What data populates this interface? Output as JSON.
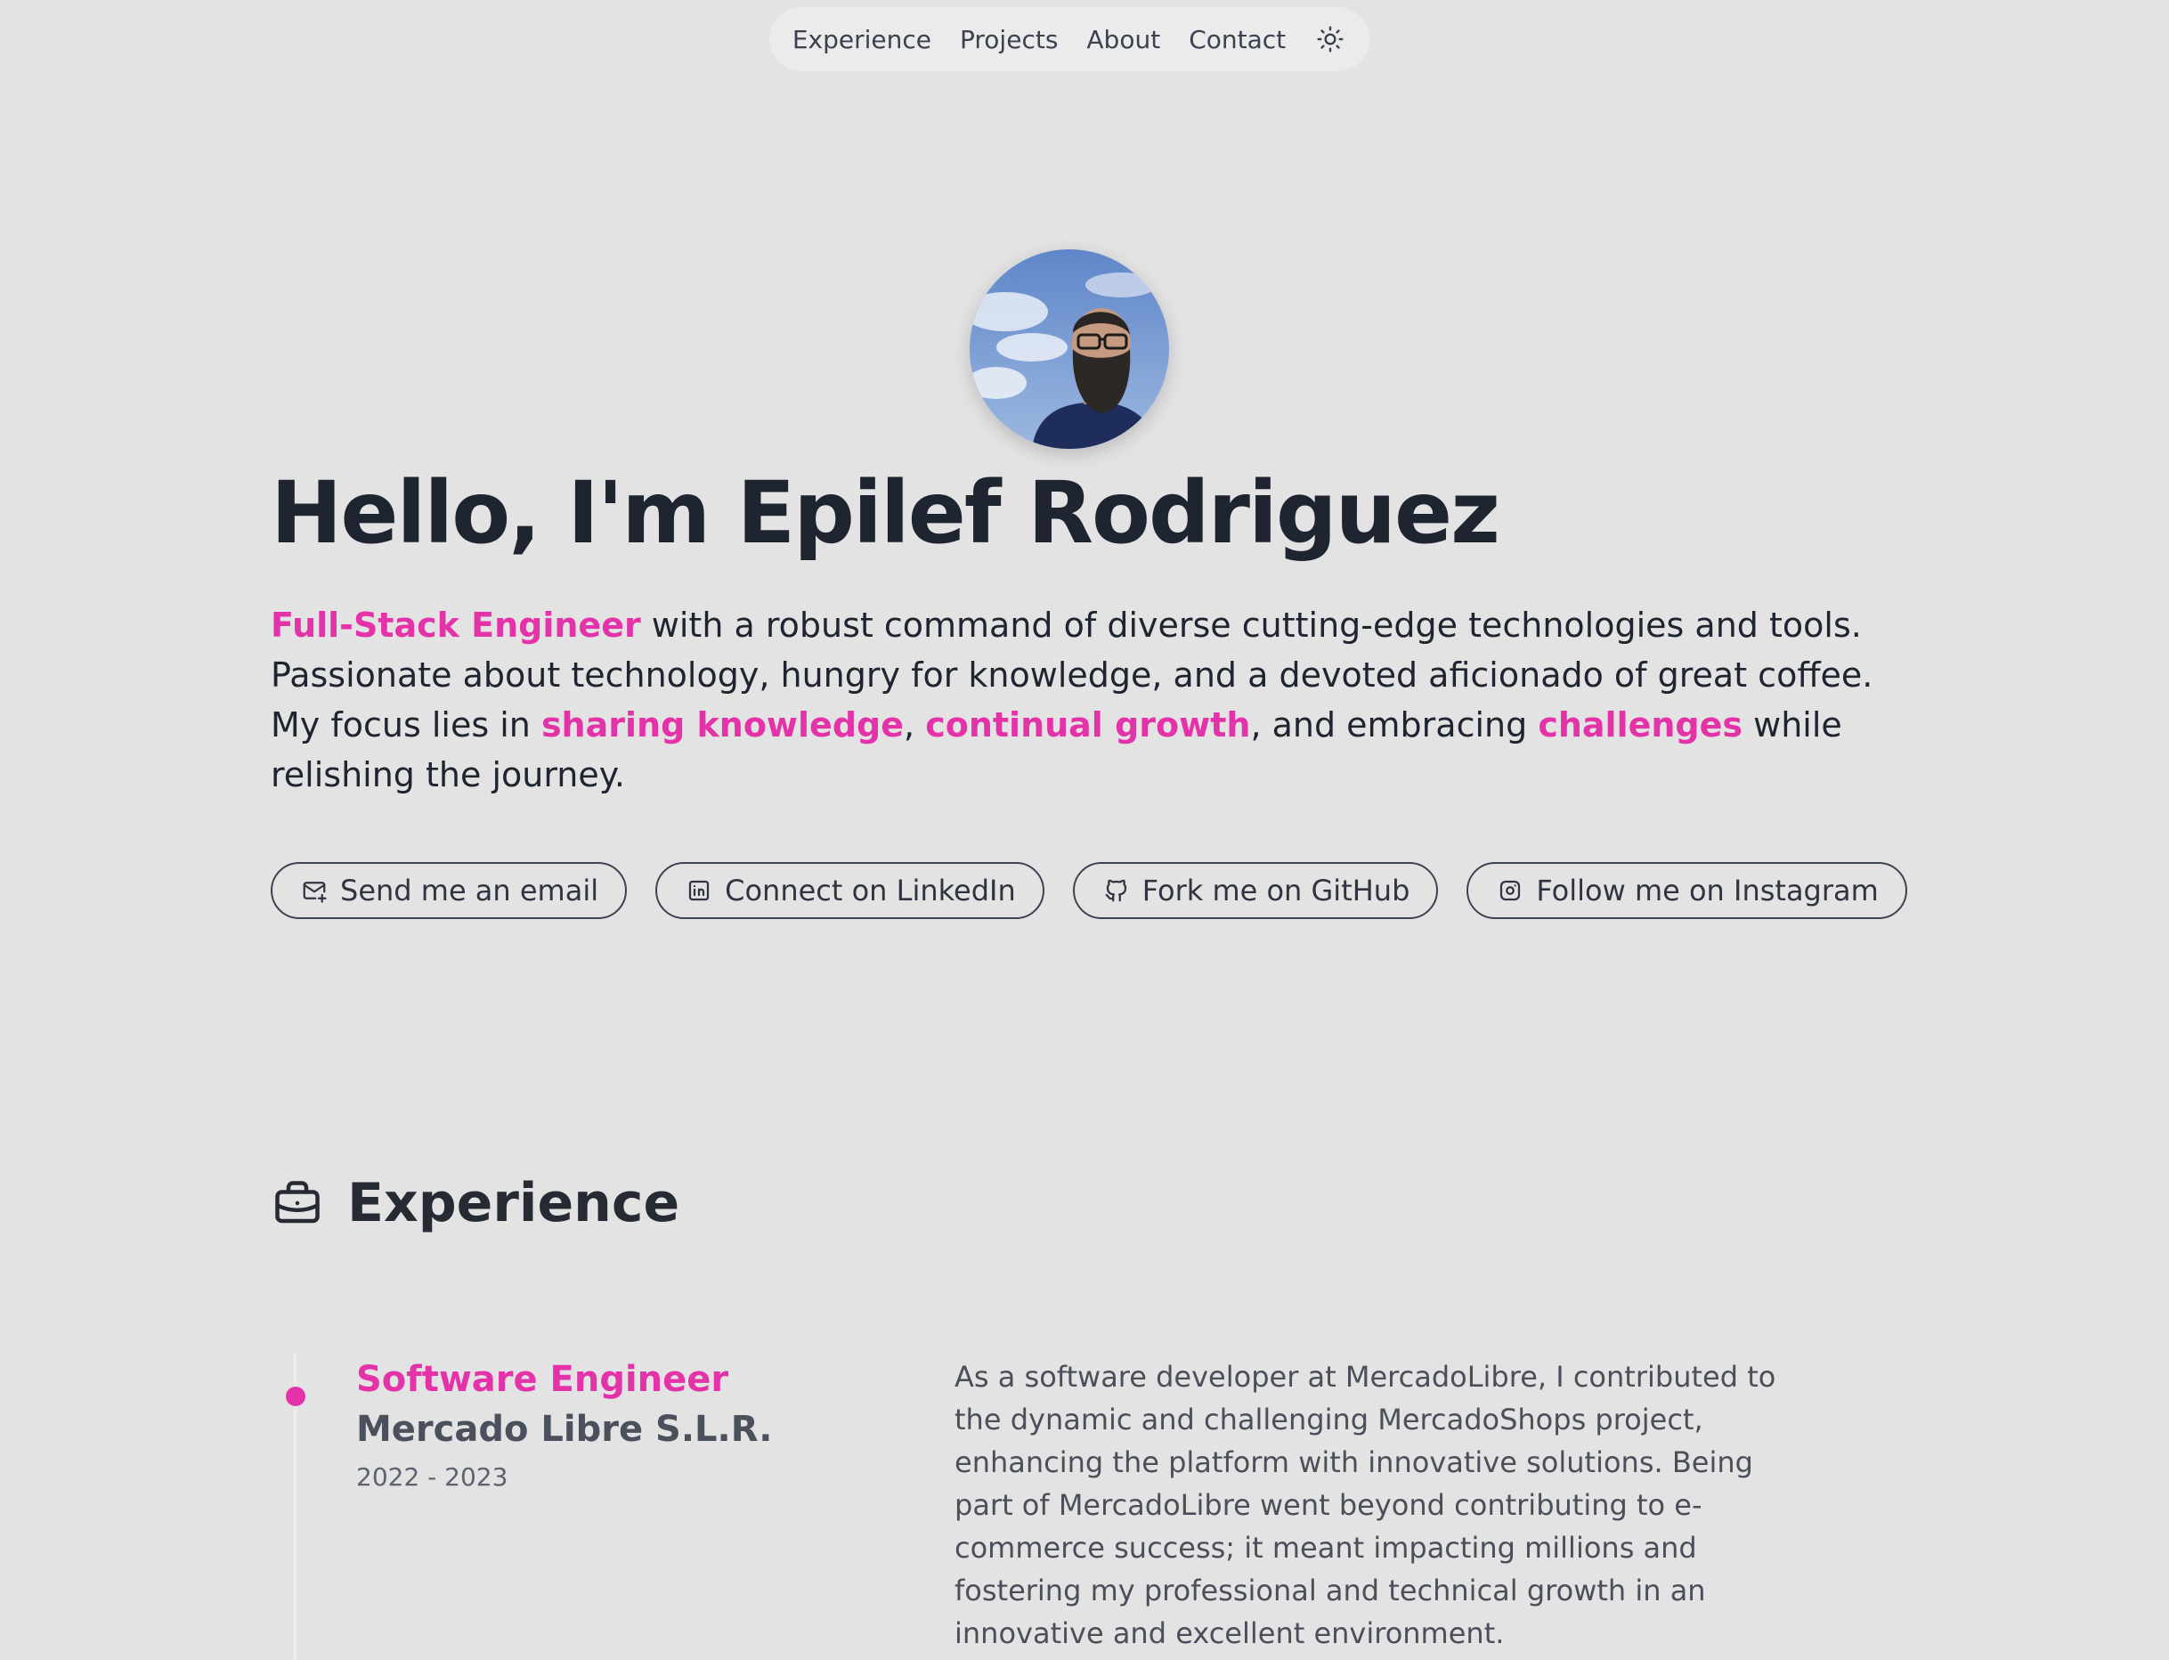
{
  "nav": {
    "items": [
      "Experience",
      "Projects",
      "About",
      "Contact"
    ],
    "theme_icon": "sun-icon"
  },
  "hero": {
    "avatar_alt": "",
    "title": "Hello, I'm Epilef Rodriguez",
    "intro": {
      "role": "Full-Stack Engineer",
      "text1": " with a robust command of diverse cutting-edge technologies and tools. Passionate about technology, hungry for knowledge, and a devoted aficionado of great coffee. My focus lies in ",
      "hl1": "sharing knowledge",
      "sep1": ", ",
      "hl2": "continual growth",
      "text2": ", and embracing ",
      "hl3": "challenges",
      "text3": " while relishing the journey."
    },
    "socials": [
      {
        "label": "Send me an email",
        "icon": "mail-icon"
      },
      {
        "label": "Connect on LinkedIn",
        "icon": "linkedin-icon"
      },
      {
        "label": "Fork me on GitHub",
        "icon": "github-icon"
      },
      {
        "label": "Follow me on Instagram",
        "icon": "instagram-icon"
      }
    ]
  },
  "experience": {
    "heading": "Experience",
    "heading_icon": "briefcase-icon",
    "jobs": [
      {
        "role": "Software Engineer",
        "company": "Mercado Libre S.L.R.",
        "dates": "2022 - 2023",
        "description": "As a software developer at MercadoLibre, I contributed to the dynamic and challenging MercadoShops project, enhancing the platform with innovative solutions. Being part of MercadoLibre went beyond contributing to e-commerce success; it meant impacting millions and fostering my professional and technical growth in an innovative and excellent environment."
      }
    ]
  },
  "colors": {
    "accent": "#e432a8",
    "background": "#e3e3e4",
    "text": "#1f2530"
  }
}
